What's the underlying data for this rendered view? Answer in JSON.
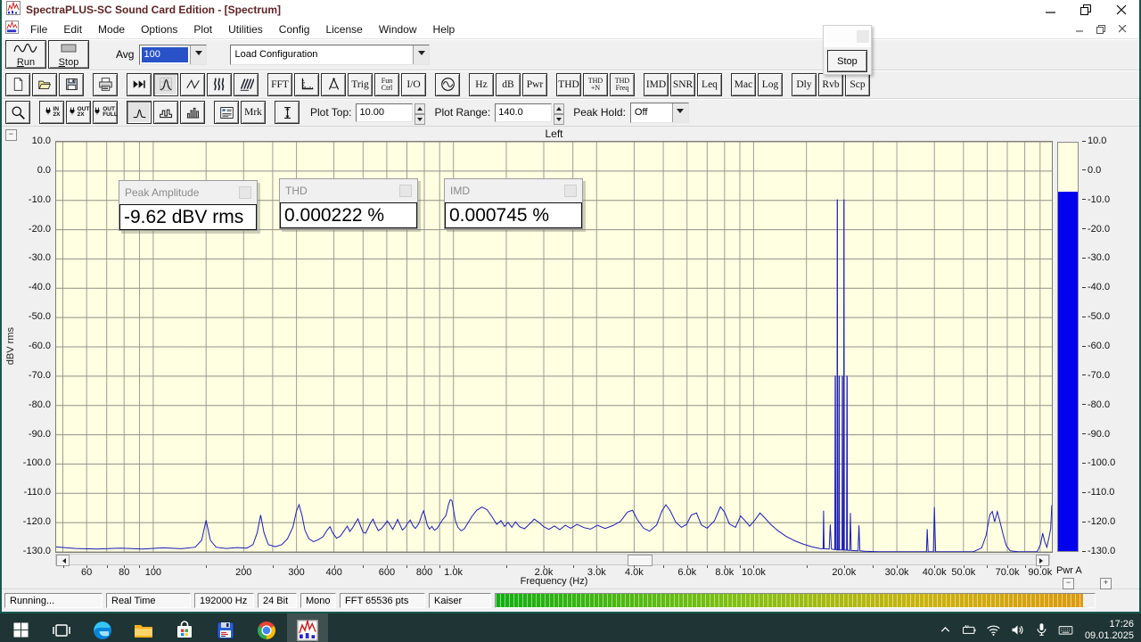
{
  "colors": {
    "trace": "#1c1cb8",
    "meter_fill": "#0202ee",
    "plot_bg": "#ffffe1",
    "grid": "#9e9e96",
    "taskbar_bg": "#1f3434",
    "title_text": "#5e2323",
    "selection_bg": "#2a52c8",
    "window_border": "#17594e"
  },
  "window": {
    "title": "SpectraPLUS-SC Sound Card Edition - [Spectrum]"
  },
  "menu": {
    "items": [
      "File",
      "Edit",
      "Mode",
      "Options",
      "Plot",
      "Utilities",
      "Config",
      "License",
      "Window",
      "Help"
    ]
  },
  "transport": {
    "run_label": "Run",
    "stop_label": "Stop",
    "avg_label": "Avg",
    "avg_value": "100",
    "config_value": "Load Configuration"
  },
  "floating_toolbar": {
    "stop_label": "Stop"
  },
  "toolbar_icons": [
    {
      "name": "new-file-button",
      "icon": "doc"
    },
    {
      "name": "open-file-button",
      "icon": "folder"
    },
    {
      "name": "save-button",
      "icon": "floppy"
    },
    {
      "name": "print-button",
      "icon": "printer",
      "gap": true
    },
    {
      "name": "process-button",
      "icon": "ffwd",
      "gap": true
    },
    {
      "name": "spectrum-view-button",
      "icon": "spectrum",
      "pressed": true
    },
    {
      "name": "time-series-view-button",
      "icon": "wave"
    },
    {
      "name": "spectrogram-view-button",
      "icon": "sgram"
    },
    {
      "name": "surface-view-button",
      "icon": "surface"
    },
    {
      "name": "fft-settings-button",
      "label": "FFT",
      "gap": true
    },
    {
      "name": "scaling-button",
      "icon": "ruler"
    },
    {
      "name": "calipers-button",
      "icon": "calipers"
    },
    {
      "name": "trigger-button",
      "label": "Trig"
    },
    {
      "name": "function-control-button",
      "lines": [
        "Fun",
        "Ctrl"
      ]
    },
    {
      "name": "io-button",
      "label": "I/O"
    },
    {
      "name": "signal-generator-button",
      "icon": "gen",
      "gap": true
    },
    {
      "name": "hz-button",
      "label": "Hz",
      "gap": true
    },
    {
      "name": "db-button",
      "label": "dB"
    },
    {
      "name": "pwr-button",
      "label": "Pwr"
    },
    {
      "name": "thd-button",
      "label": "THD",
      "gap": true
    },
    {
      "name": "thd-n-button",
      "lines": [
        "THD",
        "+N"
      ]
    },
    {
      "name": "thd-freq-button",
      "lines": [
        "THD",
        "Freq"
      ]
    },
    {
      "name": "imd-button",
      "label": "IMD",
      "gap": true
    },
    {
      "name": "snr-button",
      "label": "SNR"
    },
    {
      "name": "leq-button",
      "label": "Leq"
    },
    {
      "name": "macro-button",
      "label": "Mac",
      "gap": true
    },
    {
      "name": "log-button",
      "label": "Log"
    },
    {
      "name": "delay-button",
      "label": "Dly",
      "gap": true
    },
    {
      "name": "reverb-button",
      "label": "Rvb"
    },
    {
      "name": "scope-button",
      "label": "Scp"
    }
  ],
  "toolbar_view": [
    {
      "name": "zoom-button",
      "icon": "zoom"
    },
    {
      "name": "zoom-in-2x-button",
      "icon": "plug",
      "tiny": [
        "IN",
        "2X"
      ],
      "gap": true
    },
    {
      "name": "zoom-out-2x-button",
      "icon": "plug",
      "tiny": [
        "OUT",
        "2X"
      ]
    },
    {
      "name": "zoom-out-full-button",
      "icon": "plug",
      "tiny": [
        "OUT",
        "FULL"
      ]
    },
    {
      "name": "narrowband-button",
      "icon": "peak",
      "pressed": true,
      "gap": true
    },
    {
      "name": "octave-button",
      "icon": "octave"
    },
    {
      "name": "bar-graph-button",
      "icon": "bars"
    },
    {
      "name": "display-options-button",
      "icon": "panel",
      "gap": true
    },
    {
      "name": "marker-button",
      "label": "Mrk"
    },
    {
      "name": "amplitude-scale-button",
      "icon": "ibeam",
      "gap": true
    }
  ],
  "plot_controls": {
    "plot_top_label": "Plot Top:",
    "plot_top_value": "10.00",
    "plot_range_label": "Plot Range:",
    "plot_range_value": "140.0",
    "peak_hold_label": "Peak Hold:",
    "peak_hold_value": "Off"
  },
  "overlays": [
    {
      "title": "Peak Amplitude",
      "value": "-9.62 dBV rms"
    },
    {
      "title": "THD",
      "value": "0.000222 %"
    },
    {
      "title": "IMD",
      "value": "0.000745 %"
    }
  ],
  "plot": {
    "title": "Left",
    "ylabel": "dBV rms",
    "xlabel": "Frequency (Hz)",
    "meter_label": "Pwr A",
    "meter_level_db": -6.6,
    "y_ticks": [
      10,
      0,
      -10,
      -20,
      -30,
      -40,
      -50,
      -60,
      -70,
      -80,
      -90,
      -100,
      -110,
      -120,
      -130
    ],
    "x_ticks": [
      {
        "f": 60,
        "label": "60"
      },
      {
        "f": 80,
        "label": "80"
      },
      {
        "f": 100,
        "label": "100"
      },
      {
        "f": 200,
        "label": "200"
      },
      {
        "f": 300,
        "label": "300"
      },
      {
        "f": 400,
        "label": "400"
      },
      {
        "f": 600,
        "label": "600"
      },
      {
        "f": 800,
        "label": "800"
      },
      {
        "f": 1000,
        "label": "1.0k"
      },
      {
        "f": 2000,
        "label": "2.0k"
      },
      {
        "f": 3000,
        "label": "3.0k"
      },
      {
        "f": 4000,
        "label": "4.0k"
      },
      {
        "f": 6000,
        "label": "6.0k"
      },
      {
        "f": 8000,
        "label": "8.0k"
      },
      {
        "f": 10000,
        "label": "10.0k"
      },
      {
        "f": 20000,
        "label": "20.0k"
      },
      {
        "f": 30000,
        "label": "30.0k"
      },
      {
        "f": 40000,
        "label": "40.0k"
      },
      {
        "f": 50000,
        "label": "50.0k"
      },
      {
        "f": 70000,
        "label": "70.0k"
      },
      {
        "f": 90000,
        "label": "90.0k"
      }
    ]
  },
  "chart_data": {
    "type": "line",
    "title": "Left",
    "xlabel": "Frequency (Hz)",
    "ylabel": "dBV rms",
    "xscale": "log",
    "xlim": [
      47.5,
      98500
    ],
    "ylim": [
      -130,
      10
    ],
    "grid": true,
    "x_gridlines": [
      50,
      60,
      70,
      80,
      90,
      100,
      150,
      200,
      250,
      300,
      400,
      500,
      600,
      700,
      800,
      900,
      1000,
      1500,
      2000,
      2500,
      3000,
      4000,
      5000,
      6000,
      7000,
      8000,
      9000,
      10000,
      15000,
      20000,
      25000,
      30000,
      40000,
      50000,
      60000,
      70000,
      80000,
      90000
    ],
    "main_tones": [
      {
        "f": 19000,
        "db": -9.8
      },
      {
        "f": 20000,
        "db": -9.8
      }
    ],
    "points": [
      [
        47.5,
        -128.3
      ],
      [
        55,
        -128.8
      ],
      [
        65,
        -129
      ],
      [
        78,
        -128.7
      ],
      [
        92,
        -129
      ],
      [
        108,
        -128.6
      ],
      [
        124,
        -128.9
      ],
      [
        138,
        -128.4
      ],
      [
        145,
        -126
      ],
      [
        150,
        -119.2
      ],
      [
        155,
        -126
      ],
      [
        162,
        -128.4
      ],
      [
        175,
        -128.8
      ],
      [
        190,
        -128.5
      ],
      [
        205,
        -128.7
      ],
      [
        215,
        -127.5
      ],
      [
        222,
        -123.5
      ],
      [
        228,
        -117.4
      ],
      [
        234,
        -123.5
      ],
      [
        242,
        -127.5
      ],
      [
        255,
        -128.2
      ],
      [
        268,
        -127.5
      ],
      [
        280,
        -125.5
      ],
      [
        292,
        -121.5
      ],
      [
        300,
        -116
      ],
      [
        306,
        -113.9
      ],
      [
        313,
        -117.5
      ],
      [
        320,
        -122.5
      ],
      [
        330,
        -125.5
      ],
      [
        342,
        -126.5
      ],
      [
        355,
        -125.8
      ],
      [
        368,
        -124.8
      ],
      [
        380,
        -122.5
      ],
      [
        388,
        -121.4
      ],
      [
        396,
        -123.5
      ],
      [
        408,
        -125.3
      ],
      [
        420,
        -124.6
      ],
      [
        432,
        -122.8
      ],
      [
        443,
        -121.2
      ],
      [
        452,
        -123
      ],
      [
        462,
        -121.7
      ],
      [
        472,
        -120
      ],
      [
        481,
        -118.7
      ],
      [
        490,
        -121
      ],
      [
        500,
        -123.3
      ],
      [
        510,
        -123.6
      ],
      [
        520,
        -121.8
      ],
      [
        530,
        -120
      ],
      [
        540,
        -118.8
      ],
      [
        550,
        -120.8
      ],
      [
        562,
        -122.7
      ],
      [
        576,
        -122
      ],
      [
        590,
        -120.7
      ],
      [
        602,
        -119.4
      ],
      [
        615,
        -120.8
      ],
      [
        628,
        -122.3
      ],
      [
        642,
        -120.4
      ],
      [
        652,
        -118.9
      ],
      [
        663,
        -120.6
      ],
      [
        676,
        -122.5
      ],
      [
        690,
        -121.7
      ],
      [
        704,
        -120.2
      ],
      [
        718,
        -119.1
      ],
      [
        732,
        -120.9
      ],
      [
        746,
        -122
      ],
      [
        760,
        -121
      ],
      [
        772,
        -119.6
      ],
      [
        784,
        -117.4
      ],
      [
        795,
        -116
      ],
      [
        806,
        -118
      ],
      [
        818,
        -120.8
      ],
      [
        832,
        -122.2
      ],
      [
        848,
        -121.3
      ],
      [
        865,
        -122.6
      ],
      [
        882,
        -122
      ],
      [
        900,
        -120.6
      ],
      [
        920,
        -119
      ],
      [
        945,
        -117.5
      ],
      [
        962,
        -114
      ],
      [
        975,
        -112.2
      ],
      [
        988,
        -112.4
      ],
      [
        1000,
        -115.5
      ],
      [
        1015,
        -119.3
      ],
      [
        1035,
        -121.6
      ],
      [
        1060,
        -122.8
      ],
      [
        1085,
        -122.2
      ],
      [
        1115,
        -120.3
      ],
      [
        1150,
        -118
      ],
      [
        1195,
        -115.8
      ],
      [
        1245,
        -114.7
      ],
      [
        1295,
        -115.6
      ],
      [
        1345,
        -118
      ],
      [
        1395,
        -120.6
      ],
      [
        1440,
        -119.3
      ],
      [
        1480,
        -121.3
      ],
      [
        1520,
        -119.9
      ],
      [
        1565,
        -121.6
      ],
      [
        1610,
        -119.7
      ],
      [
        1660,
        -121.4
      ],
      [
        1725,
        -122.1
      ],
      [
        1795,
        -120.4
      ],
      [
        1860,
        -118.8
      ],
      [
        1930,
        -120
      ],
      [
        2000,
        -121.4
      ],
      [
        2080,
        -122.3
      ],
      [
        2170,
        -121.1
      ],
      [
        2260,
        -122.4
      ],
      [
        2360,
        -120.9
      ],
      [
        2460,
        -121.9
      ],
      [
        2580,
        -120.6
      ],
      [
        2720,
        -121.7
      ],
      [
        2860,
        -122.2
      ],
      [
        3020,
        -120.9
      ],
      [
        3200,
        -122
      ],
      [
        3400,
        -121
      ],
      [
        3600,
        -119.6
      ],
      [
        3800,
        -116.4
      ],
      [
        3950,
        -115.8
      ],
      [
        4100,
        -119
      ],
      [
        4300,
        -121.9
      ],
      [
        4500,
        -122.9
      ],
      [
        4750,
        -120.8
      ],
      [
        4950,
        -116
      ],
      [
        5100,
        -113.9
      ],
      [
        5280,
        -116
      ],
      [
        5500,
        -119.8
      ],
      [
        5750,
        -121.6
      ],
      [
        5980,
        -120.6
      ],
      [
        6200,
        -117.4
      ],
      [
        6450,
        -116.7
      ],
      [
        6700,
        -120.8
      ],
      [
        7000,
        -121.9
      ],
      [
        7400,
        -119.4
      ],
      [
        7750,
        -114.6
      ],
      [
        8000,
        -116.4
      ],
      [
        8300,
        -120.4
      ],
      [
        8700,
        -121.6
      ],
      [
        9050,
        -117.7
      ],
      [
        9350,
        -119.3
      ],
      [
        9700,
        -121.2
      ],
      [
        10100,
        -119.1
      ],
      [
        10500,
        -116.7
      ],
      [
        10900,
        -118.4
      ],
      [
        11400,
        -120.6
      ],
      [
        12000,
        -122.6
      ],
      [
        12800,
        -124.6
      ],
      [
        13700,
        -126.2
      ],
      [
        14700,
        -127.4
      ],
      [
        15700,
        -128.3
      ],
      [
        16600,
        -128.8
      ],
      [
        17040,
        -128.9
      ],
      [
        17100,
        -115.9
      ],
      [
        17170,
        -128.9
      ],
      [
        17850,
        -129
      ],
      [
        18000,
        -120.6
      ],
      [
        18160,
        -129
      ],
      [
        18640,
        -129.2
      ],
      [
        18690,
        -70
      ],
      [
        18730,
        -70
      ],
      [
        18780,
        -129.2
      ],
      [
        18955,
        -129.3
      ],
      [
        18990,
        -9.8
      ],
      [
        19010,
        -9.8
      ],
      [
        19045,
        -129.3
      ],
      [
        19210,
        -129.3
      ],
      [
        19245,
        -70
      ],
      [
        19280,
        -70
      ],
      [
        19330,
        -129.3
      ],
      [
        19700,
        -129.3
      ],
      [
        19740,
        -70
      ],
      [
        19775,
        -70
      ],
      [
        19825,
        -129.3
      ],
      [
        19955,
        -129.3
      ],
      [
        19990,
        -9.8
      ],
      [
        20010,
        -9.8
      ],
      [
        20048,
        -129.3
      ],
      [
        20400,
        -129.4
      ],
      [
        20450,
        -70
      ],
      [
        20490,
        -70
      ],
      [
        20545,
        -129.4
      ],
      [
        20900,
        -129.5
      ],
      [
        21010,
        -116.7
      ],
      [
        21130,
        -129.5
      ],
      [
        22280,
        -129.6
      ],
      [
        22430,
        -120.9
      ],
      [
        22590,
        -129.6
      ],
      [
        23500,
        -129.8
      ],
      [
        26000,
        -129.9
      ],
      [
        30000,
        -129.9
      ],
      [
        34000,
        -129.9
      ],
      [
        37650,
        -129.9
      ],
      [
        37880,
        -122.2
      ],
      [
        38120,
        -129.9
      ],
      [
        39700,
        -129.9
      ],
      [
        40000,
        -114.7
      ],
      [
        40380,
        -129.9
      ],
      [
        43000,
        -129.9
      ],
      [
        48000,
        -129.9
      ],
      [
        54000,
        -129.9
      ],
      [
        57500,
        -128.6
      ],
      [
        59500,
        -124.3
      ],
      [
        61200,
        -117.3
      ],
      [
        62400,
        -116.2
      ],
      [
        63500,
        -119.7
      ],
      [
        64800,
        -116.2
      ],
      [
        66100,
        -119.6
      ],
      [
        67700,
        -123.9
      ],
      [
        69400,
        -127.8
      ],
      [
        71500,
        -129.6
      ],
      [
        76000,
        -129.9
      ],
      [
        82000,
        -129.9
      ],
      [
        88000,
        -129.9
      ],
      [
        90300,
        -127.4
      ],
      [
        91800,
        -123.6
      ],
      [
        93300,
        -126.6
      ],
      [
        94800,
        -128.4
      ],
      [
        96300,
        -125.2
      ],
      [
        97600,
        -122
      ],
      [
        98400,
        -114
      ]
    ]
  },
  "statusbar": {
    "fields": [
      "Running...",
      "Real Time",
      "192000 Hz",
      "24 Bit",
      "Mono",
      "FFT 65536 pts",
      "Kaiser"
    ],
    "progress_percent": 98
  },
  "taskbar": {
    "time": "17:26",
    "date": "09.01.2025"
  }
}
